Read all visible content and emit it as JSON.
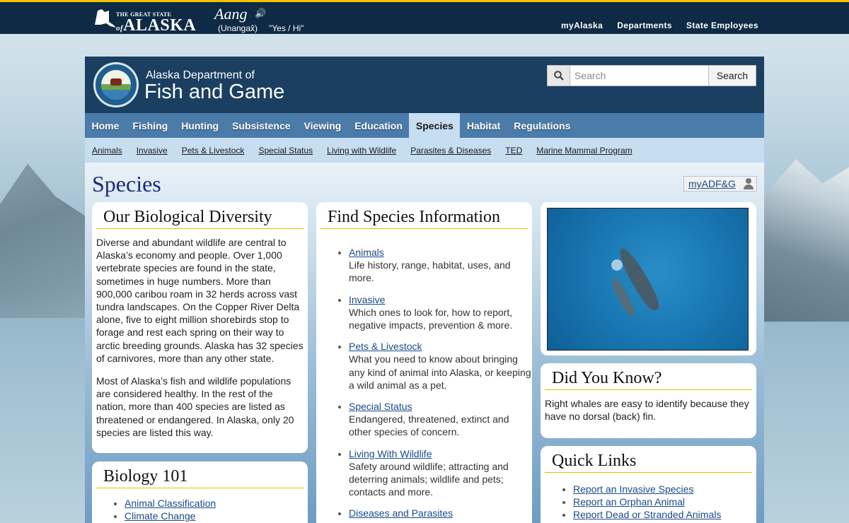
{
  "state_bar": {
    "logo_small": "THE GREAT STATE",
    "logo_of": "of",
    "logo_big": "ALASKA",
    "word": "Aang",
    "language": "(Unangax̂)",
    "translation": "\"Yes / Hi\"",
    "links": [
      "myAlaska",
      "Departments",
      "State Employees"
    ]
  },
  "header": {
    "dept_small": "Alaska Department of",
    "dept_big": "Fish and Game",
    "search_placeholder": "Search",
    "search_button": "Search"
  },
  "nav": {
    "items": [
      "Home",
      "Fishing",
      "Hunting",
      "Subsistence",
      "Viewing",
      "Education",
      "Species",
      "Habitat",
      "Regulations"
    ],
    "active": "Species"
  },
  "subnav": {
    "items": [
      "Animals",
      "Invasive",
      "Pets & Livestock",
      "Special Status",
      "Living with Wildlife",
      "Parasites & Diseases",
      "TED",
      "Marine Mammal Program"
    ]
  },
  "page": {
    "title": "Species",
    "myadfg": "myADF&G"
  },
  "biodiversity": {
    "heading": "Our Biological Diversity",
    "p1": "Diverse and abundant wildlife are central to Alaska’s economy and people. Over 1,000 vertebrate species are found in the state, sometimes in huge numbers. More than 900,000 caribou roam in 32 herds across vast tundra landscapes. On the Copper River Delta alone, five to eight million shorebirds stop to forage and rest each spring on their way to arctic breeding grounds. Alaska has 32 species of carnivores, more than any other state.",
    "p2": "Most of Alaska’s fish and wildlife populations are considered healthy. In the rest of the nation, more than 400 species are listed as threatened or endangered. In Alaska, only 20 species are listed this way."
  },
  "biology101": {
    "heading": "Biology 101",
    "links": [
      "Animal Classification",
      "Climate Change"
    ]
  },
  "find_species": {
    "heading": "Find Species Information",
    "items": [
      {
        "link": "Animals",
        "desc": "Life history, range, habitat, uses, and more."
      },
      {
        "link": "Invasive",
        "desc": "Which ones to look for, how to report, negative impacts, prevention & more."
      },
      {
        "link": "Pets & Livestock",
        "desc": "What you need to know about bringing any kind of animal into Alaska, or keeping a wild animal as a pet."
      },
      {
        "link": "Special Status",
        "desc": "Endangered, threatened, extinct and other species of concern."
      },
      {
        "link": "Living With Wildlife",
        "desc": "Safety around wildlife; attracting and deterring animals; wildlife and pets; contacts and more."
      },
      {
        "link": "Diseases and Parasites",
        "desc": ""
      }
    ]
  },
  "did_you_know": {
    "heading": "Did You Know?",
    "text": "Right whales are easy to identify because they have no dorsal (back) fin."
  },
  "quick_links": {
    "heading": "Quick Links",
    "links": [
      "Report an Invasive Species",
      "Report an Orphan Animal",
      "Report Dead or Stranded Animals"
    ]
  }
}
